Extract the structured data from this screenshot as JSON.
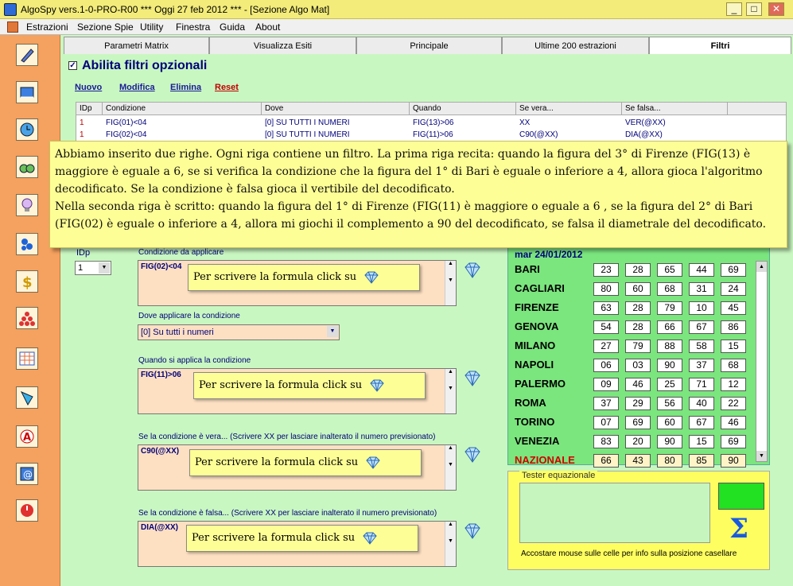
{
  "window": {
    "title": "AlgoSpy vers.1-0-PRO-R00  ***  Oggi 27 feb 2012  ***   - [Sezione Algo Mat]",
    "controls": [
      "_",
      "□",
      "✕"
    ]
  },
  "menu": {
    "items": [
      "Estrazioni",
      "Sezione Spie",
      "Utility",
      "Finestra",
      "Guida",
      "About"
    ]
  },
  "sidebar": {
    "icons": [
      "pen-icon",
      "book-icon",
      "clock-icon",
      "binoculars-icon",
      "lightbulb-icon",
      "lottery-balls-icon",
      "dollar-icon",
      "pyramid-icon",
      "calendar-icon",
      "shape-icon",
      "letter-a-icon",
      "at-sign-icon",
      "power-icon"
    ]
  },
  "tabs": [
    "Parametri Matrix",
    "Visualizza Esiti",
    "Principale",
    "Ultime 200 estrazioni",
    "Filtri"
  ],
  "active_tab": "Filtri",
  "enable_filters": {
    "label": "Abilita filtri opzionali",
    "checked": true
  },
  "actions": {
    "nuovo": "Nuovo",
    "modifica": "Modifica",
    "elimina": "Elimina",
    "reset": "Reset"
  },
  "grid": {
    "headers": [
      "IDp",
      "Condizione",
      "Dove",
      "Quando",
      "Se vera...",
      "Se falsa..."
    ],
    "rows": [
      [
        "1",
        "FIG(01)<04",
        "[0] SU TUTTI I NUMERI",
        "FIG(13)>06",
        "XX",
        "VER(@XX)"
      ],
      [
        "1",
        "FIG(02)<04",
        "[0] SU TUTTI I NUMERI",
        "FIG(11)>06",
        "C90(@XX)",
        "DIA(@XX)"
      ]
    ]
  },
  "note": {
    "paragraph1": "Abbiamo inserito due righe. Ogni riga contiene un filtro. La prima riga recita: quando la figura del 3° di Firenze (FIG(13) è maggiore è eguale a 6, se si verifica la condizione che la figura del 1° di Bari è eguale o inferiore a 4, allora gioca l'algoritmo decodificato. Se la condizione è falsa gioca il vertibile del decodificato.",
    "paragraph2": "Nella seconda riga è scritto: quando la figura del 1° di Firenze (FIG(11) è maggiore o eguale a 6 , se la figura del 2° di Bari (FIG(02) è eguale o inferiore a 4, allora mi giochi il complemento a 90 del decodificato, se falsa il diametrale del decodificato."
  },
  "form": {
    "idp_label": "IDp",
    "idp_value": "1",
    "condizione_label": "Condizione da applicare",
    "condizione_value": "FIG(02)<04",
    "dove_label": "Dove applicare la condizione",
    "dove_value": "[0] Su tutti i numeri",
    "quando_label": "Quando si applica la condizione",
    "quando_value": "FIG(11)>06",
    "vera_label": "Se la condizione è vera... (Scrivere XX per lasciare inalterato il numero previsionato)",
    "vera_value": "C90(@XX)",
    "falsa_label": "Se la condizione è falsa...  (Scrivere XX per lasciare inalterato il numero previsionato)",
    "falsa_value": "DIA(@XX)",
    "click_hint": "Per scrivere la formula click su"
  },
  "extraction": {
    "date": "mar 24/01/2012",
    "wheels": [
      {
        "city": "BARI",
        "numbers": [
          "23",
          "28",
          "65",
          "44",
          "69"
        ]
      },
      {
        "city": "CAGLIARI",
        "numbers": [
          "80",
          "60",
          "68",
          "31",
          "24"
        ]
      },
      {
        "city": "FIRENZE",
        "numbers": [
          "63",
          "28",
          "79",
          "10",
          "45"
        ]
      },
      {
        "city": "GENOVA",
        "numbers": [
          "54",
          "28",
          "66",
          "67",
          "86"
        ]
      },
      {
        "city": "MILANO",
        "numbers": [
          "27",
          "79",
          "88",
          "58",
          "15"
        ]
      },
      {
        "city": "NAPOLI",
        "numbers": [
          "06",
          "03",
          "90",
          "37",
          "68"
        ]
      },
      {
        "city": "PALERMO",
        "numbers": [
          "09",
          "46",
          "25",
          "71",
          "12"
        ]
      },
      {
        "city": "ROMA",
        "numbers": [
          "37",
          "29",
          "56",
          "40",
          "22"
        ]
      },
      {
        "city": "TORINO",
        "numbers": [
          "07",
          "69",
          "60",
          "67",
          "46"
        ]
      },
      {
        "city": "VENEZIA",
        "numbers": [
          "83",
          "20",
          "90",
          "15",
          "69"
        ]
      },
      {
        "city": "NAZIONALE",
        "numbers": [
          "66",
          "43",
          "80",
          "85",
          "90"
        ]
      }
    ]
  },
  "tester": {
    "title": "Tester equazionale",
    "hint": "Accostare mouse sulle celle per info sulla posizione casellare",
    "sigma": "Σ"
  },
  "colors": {
    "panel_green": "#c9f7c1",
    "note_yellow": "#fefe96",
    "field_peach": "#fde0c2",
    "label_navy": "#00007a",
    "reset_red": "#c00000",
    "nazionale_red": "#d00000",
    "sidebar_orange": "#f5a15f"
  }
}
